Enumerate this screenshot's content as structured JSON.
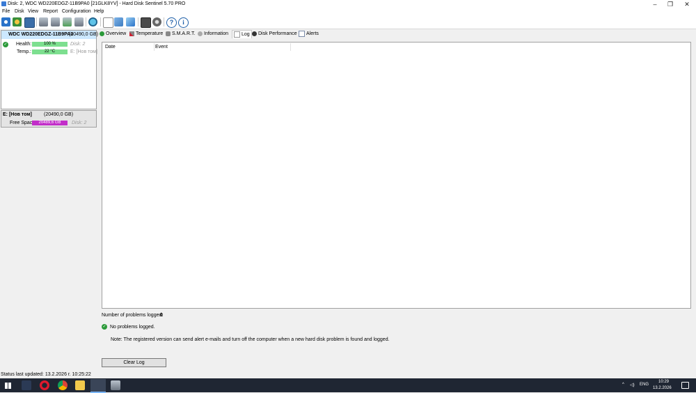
{
  "window": {
    "title": "Disk: 2, WDC WD220EDGZ-11B9PA0 [21GLK8YV]  -  Hard Disk Sentinel 5.70 PRO",
    "minimize_glyph": "–",
    "maximize_glyph": "❐",
    "close_glyph": "✕"
  },
  "menu": [
    "File",
    "Disk",
    "View",
    "Report",
    "Configuration",
    "Help"
  ],
  "toolbar": {
    "icons": [
      "refresh-icon",
      "world-icon",
      "window-icon",
      "disk-tool-1-icon",
      "disk-tool-2-icon",
      "disk-tool-3-icon",
      "disk-tool-4-icon",
      "globe-icon",
      "document-icon",
      "transfer-icon",
      "network-icon",
      "stats-icon",
      "gear-icon",
      "help-icon",
      "info-icon"
    ],
    "help_glyph": "?",
    "info_glyph": "i"
  },
  "disk": {
    "name": "WDC WD220EDGZ-11B9PA0",
    "capacity": "(20490,0 GB)",
    "health_label": "Health:",
    "health_value": "100 %",
    "health_percent": 100,
    "disk_ref": "Disk: 2",
    "temp_label": "Temp.:",
    "temp_value": "22 °C",
    "temp_ref": "E: [Нов том]"
  },
  "volume": {
    "name": "E: [Нов том]",
    "capacity": "(20490,0 GB)",
    "free_label": "Free Space",
    "free_value": "20489,6 GB",
    "free_percent": 100,
    "disk_ref": "Disk: 2"
  },
  "tabs": [
    {
      "id": "overview",
      "label": "Overview",
      "icon": "check-icon"
    },
    {
      "id": "temperature",
      "label": "Temperature",
      "icon": "thermometer-icon"
    },
    {
      "id": "smart",
      "label": "S.M.A.R.T.",
      "icon": "disk-icon"
    },
    {
      "id": "information",
      "label": "Information",
      "icon": "info-icon"
    },
    {
      "id": "log",
      "label": "Log",
      "icon": "log-icon",
      "active": true
    },
    {
      "id": "disk-performance",
      "label": "Disk Performance",
      "icon": "performance-icon"
    },
    {
      "id": "alerts",
      "label": "Alerts",
      "icon": "alerts-icon"
    }
  ],
  "log": {
    "columns": [
      "Date",
      "Event"
    ],
    "problems_label": "Number of problems logged:",
    "problems_count": "0",
    "no_problems_text": "No problems logged.",
    "note": "Note: The registered version can send alert e-mails and turn off the computer when a new hard disk problem is found and logged.",
    "clear_button": "Clear Log"
  },
  "status": {
    "text": "Status last updated: 13.2.2026 г. 10:25:22"
  },
  "taskbar": {
    "language": "ENG",
    "time": "10:29",
    "date": "13.2.2026"
  },
  "colors": {
    "health_bar": "#7ddf8f",
    "free_space_bar": "#c22ec9",
    "selected_disk": "#cce8ff",
    "taskbar": "#1f2633"
  }
}
